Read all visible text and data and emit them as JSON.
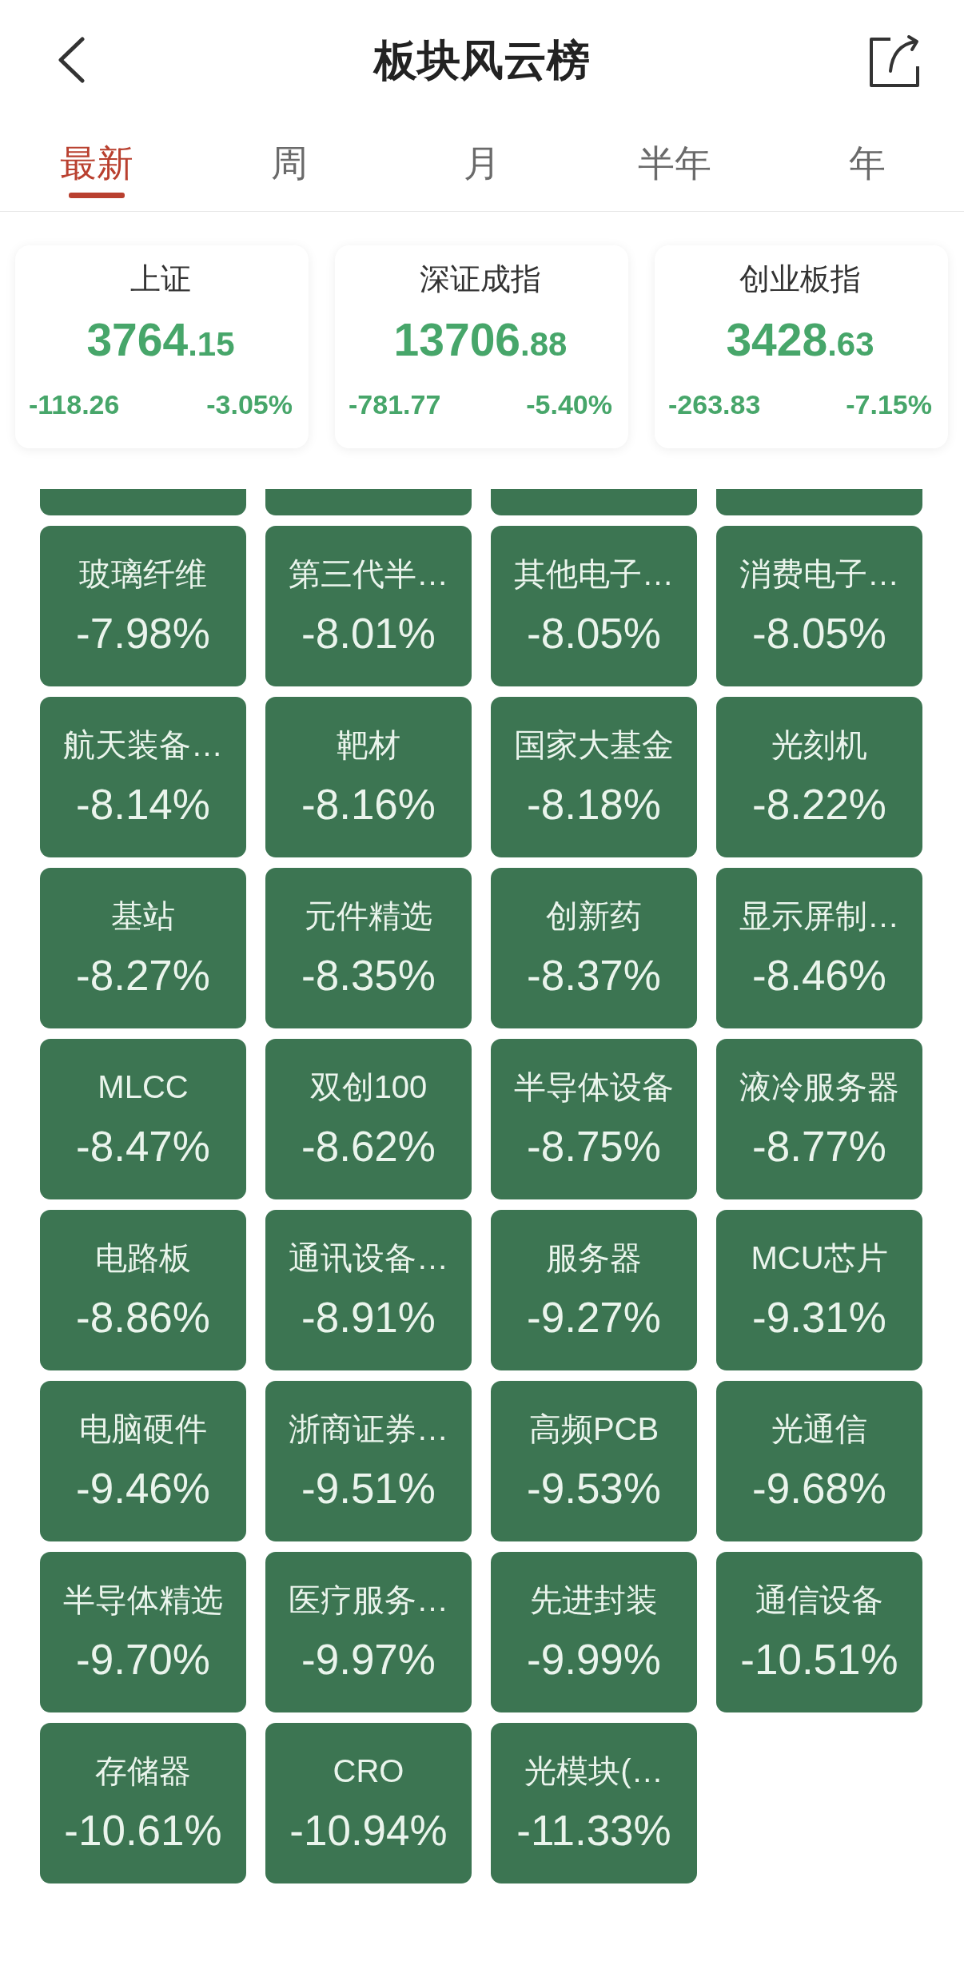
{
  "nav": {
    "title": "板块风云榜"
  },
  "tabs": [
    {
      "label": "最新",
      "selected": true
    },
    {
      "label": "周",
      "selected": false
    },
    {
      "label": "月",
      "selected": false
    },
    {
      "label": "半年",
      "selected": false
    },
    {
      "label": "年",
      "selected": false
    }
  ],
  "indices": [
    {
      "name": "上证",
      "value": "3764.15",
      "change": "-118.26",
      "change_pct": "-3.05%"
    },
    {
      "name": "深证成指",
      "value": "13706.88",
      "change": "-781.77",
      "change_pct": "-5.40%"
    },
    {
      "name": "创业板指",
      "value": "3428.63",
      "change": "-263.83",
      "change_pct": "-7.15%"
    }
  ],
  "sectors": [
    {
      "kind": "clipped"
    },
    {
      "kind": "clipped"
    },
    {
      "kind": "clipped"
    },
    {
      "kind": "clipped"
    },
    {
      "kind": "tile",
      "name": "玻璃纤维",
      "change": "-7.98%"
    },
    {
      "kind": "tile",
      "name": "第三代半…",
      "change": "-8.01%"
    },
    {
      "kind": "tile",
      "name": "其他电子…",
      "change": "-8.05%"
    },
    {
      "kind": "tile",
      "name": "消费电子…",
      "change": "-8.05%"
    },
    {
      "kind": "tile",
      "name": "航天装备…",
      "change": "-8.14%"
    },
    {
      "kind": "tile",
      "name": "靶材",
      "change": "-8.16%"
    },
    {
      "kind": "tile",
      "name": "国家大基金",
      "change": "-8.18%"
    },
    {
      "kind": "tile",
      "name": "光刻机",
      "change": "-8.22%"
    },
    {
      "kind": "tile",
      "name": "基站",
      "change": "-8.27%"
    },
    {
      "kind": "tile",
      "name": "元件精选",
      "change": "-8.35%"
    },
    {
      "kind": "tile",
      "name": "创新药",
      "change": "-8.37%"
    },
    {
      "kind": "tile",
      "name": "显示屏制…",
      "change": "-8.46%"
    },
    {
      "kind": "tile",
      "name": "MLCC",
      "change": "-8.47%"
    },
    {
      "kind": "tile",
      "name": "双创100",
      "change": "-8.62%"
    },
    {
      "kind": "tile",
      "name": "半导体设备",
      "change": "-8.75%"
    },
    {
      "kind": "tile",
      "name": "液冷服务器",
      "change": "-8.77%"
    },
    {
      "kind": "tile",
      "name": "电路板",
      "change": "-8.86%"
    },
    {
      "kind": "tile",
      "name": "通讯设备…",
      "change": "-8.91%"
    },
    {
      "kind": "tile",
      "name": "服务器",
      "change": "-9.27%"
    },
    {
      "kind": "tile",
      "name": "MCU芯片",
      "change": "-9.31%"
    },
    {
      "kind": "tile",
      "name": "电脑硬件",
      "change": "-9.46%"
    },
    {
      "kind": "tile",
      "name": "浙商证券…",
      "change": "-9.51%"
    },
    {
      "kind": "tile",
      "name": "高频PCB",
      "change": "-9.53%"
    },
    {
      "kind": "tile",
      "name": "光通信",
      "change": "-9.68%"
    },
    {
      "kind": "tile",
      "name": "半导体精选",
      "change": "-9.70%"
    },
    {
      "kind": "tile",
      "name": "医疗服务…",
      "change": "-9.97%"
    },
    {
      "kind": "tile",
      "name": "先进封装",
      "change": "-9.99%"
    },
    {
      "kind": "tile",
      "name": "通信设备",
      "change": "-10.51%"
    },
    {
      "kind": "tile",
      "name": "存储器",
      "change": "-10.61%"
    },
    {
      "kind": "tile",
      "name": "CRO",
      "change": "-10.94%"
    },
    {
      "kind": "tile",
      "name": "光模块(…",
      "change": "-11.33%"
    }
  ]
}
